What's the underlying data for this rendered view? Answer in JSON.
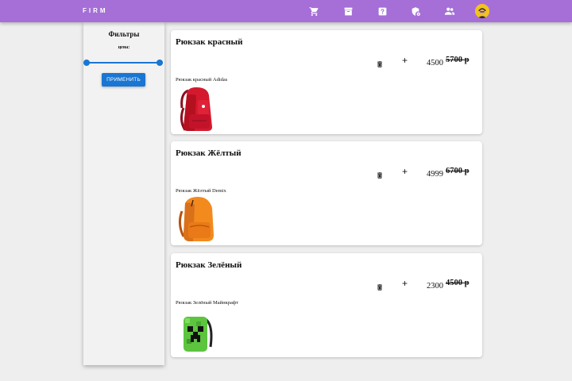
{
  "app": {
    "brand": "FIRM"
  },
  "nav": {
    "icons": [
      "cart-icon",
      "archive-icon",
      "help-icon",
      "admin-shield-icon",
      "users-icon",
      "avatar"
    ]
  },
  "filters": {
    "title": "Фильтры",
    "price_label": "цена:",
    "slider_range": [
      0,
      1
    ],
    "apply_label": "ПРИМЕНИТЬ"
  },
  "products": [
    {
      "name": "Рюкзак красный",
      "price": "4500",
      "old_price": "5700 р",
      "description": "Рюкзак красный Adidas",
      "color": "#c8142c"
    },
    {
      "name": "Рюкзак Жёлтый",
      "price": "4999",
      "old_price": "6700 р",
      "description": "Рюкзак Жёлтый Demix",
      "color": "#f08a1c"
    },
    {
      "name": "Рюкзак Зелёный",
      "price": "2300",
      "old_price": "4500 р",
      "description": "Рюкзак Зелёный Майнкрафт",
      "color": "#5cc43f"
    }
  ],
  "colors": {
    "appbar": "#a56fd7",
    "primary": "#1976d2",
    "avatar_bg": "#f2c31d"
  }
}
